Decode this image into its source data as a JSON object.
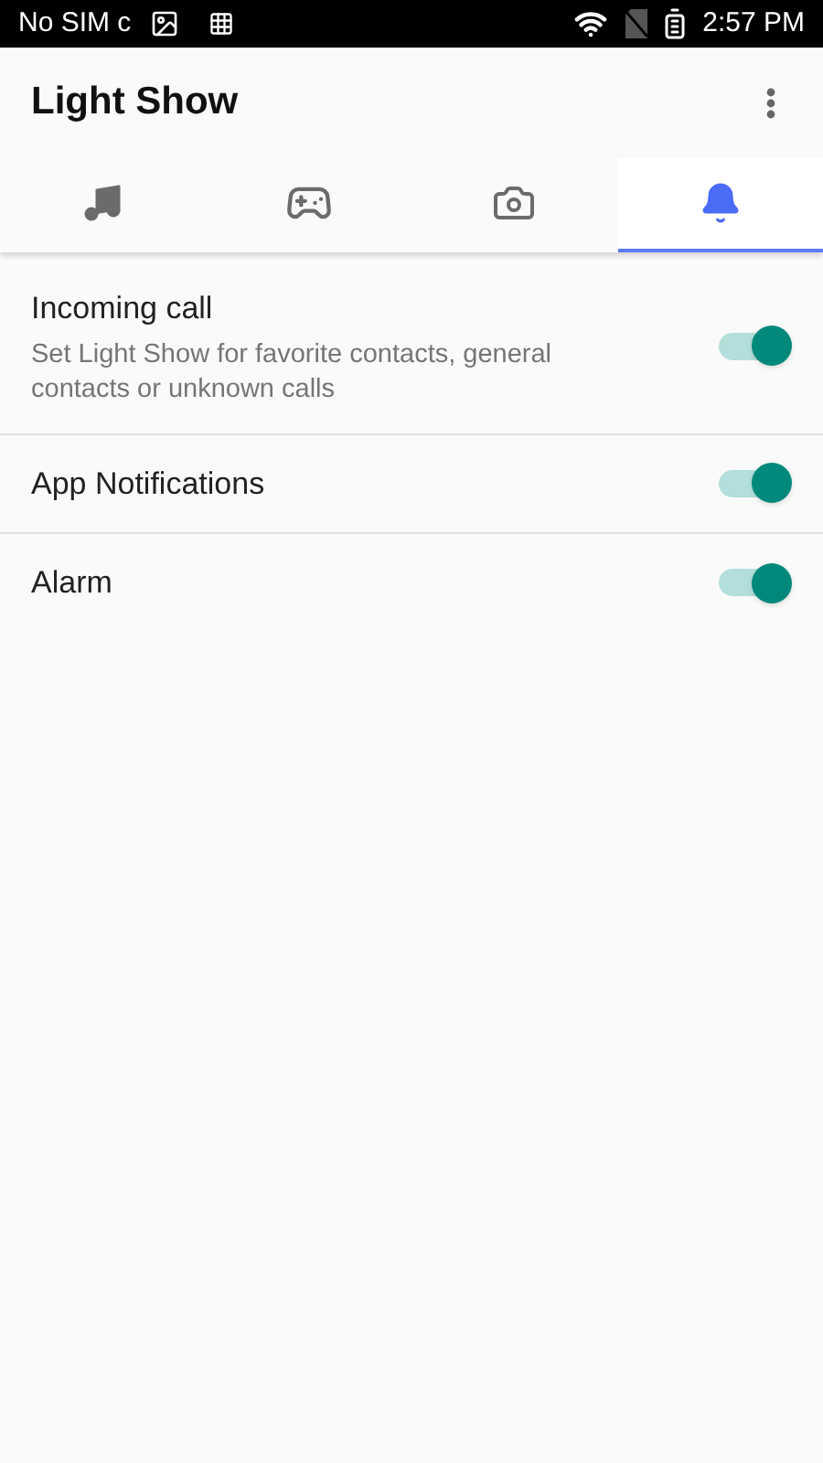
{
  "status_bar": {
    "carrier": "No SIM c",
    "time": "2:57 PM"
  },
  "app_bar": {
    "title": "Light Show"
  },
  "tabs": [
    {
      "kind": "music",
      "selected": false
    },
    {
      "kind": "gamepad",
      "selected": false
    },
    {
      "kind": "camera",
      "selected": false
    },
    {
      "kind": "bell",
      "selected": true
    }
  ],
  "settings": [
    {
      "title": "Incoming call",
      "subtitle": "Set Light Show for favorite contacts, general contacts or unknown calls",
      "on": true
    },
    {
      "title": "App Notifications",
      "on": true
    },
    {
      "title": "Alarm",
      "on": true
    }
  ]
}
